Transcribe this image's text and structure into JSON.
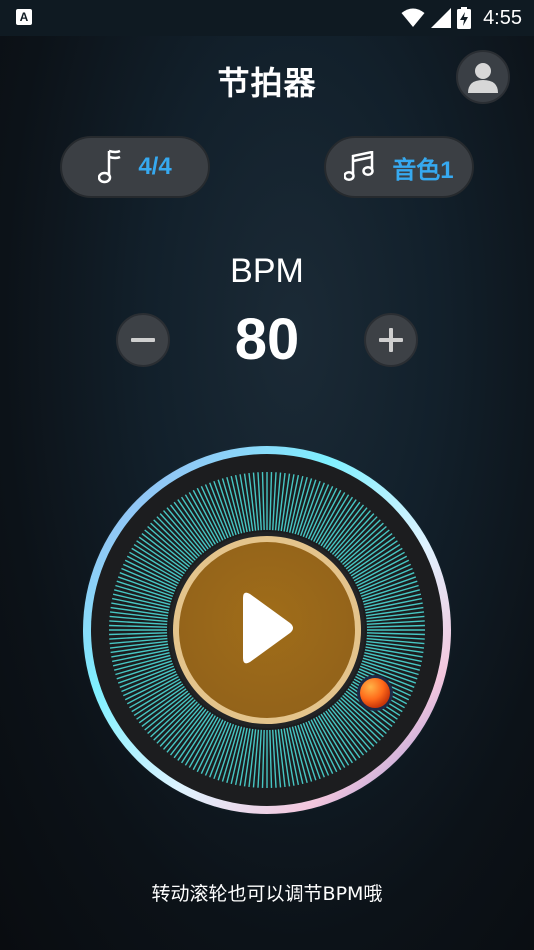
{
  "status_bar": {
    "app_indicator": "A",
    "time": "4:55",
    "icons": [
      "wifi-icon",
      "signal-icon",
      "battery-charging-icon"
    ]
  },
  "header": {
    "title": "节拍器",
    "profile_icon": "user-avatar-icon"
  },
  "controls": {
    "time_signature": {
      "icon": "music-note-icon",
      "label": "4/4"
    },
    "sound": {
      "icon": "music-notes-icon",
      "label": "音色1"
    }
  },
  "bpm": {
    "label": "BPM",
    "value": "80",
    "decrement_icon": "minus-icon",
    "increment_icon": "plus-icon"
  },
  "dial": {
    "center_icon": "play-icon",
    "knob_color": "#ff6a1a",
    "disc_color": "#9c6a18",
    "ring_color": "#4ad0cc"
  },
  "hint": "转动滚轮也可以调节BPM哦"
}
